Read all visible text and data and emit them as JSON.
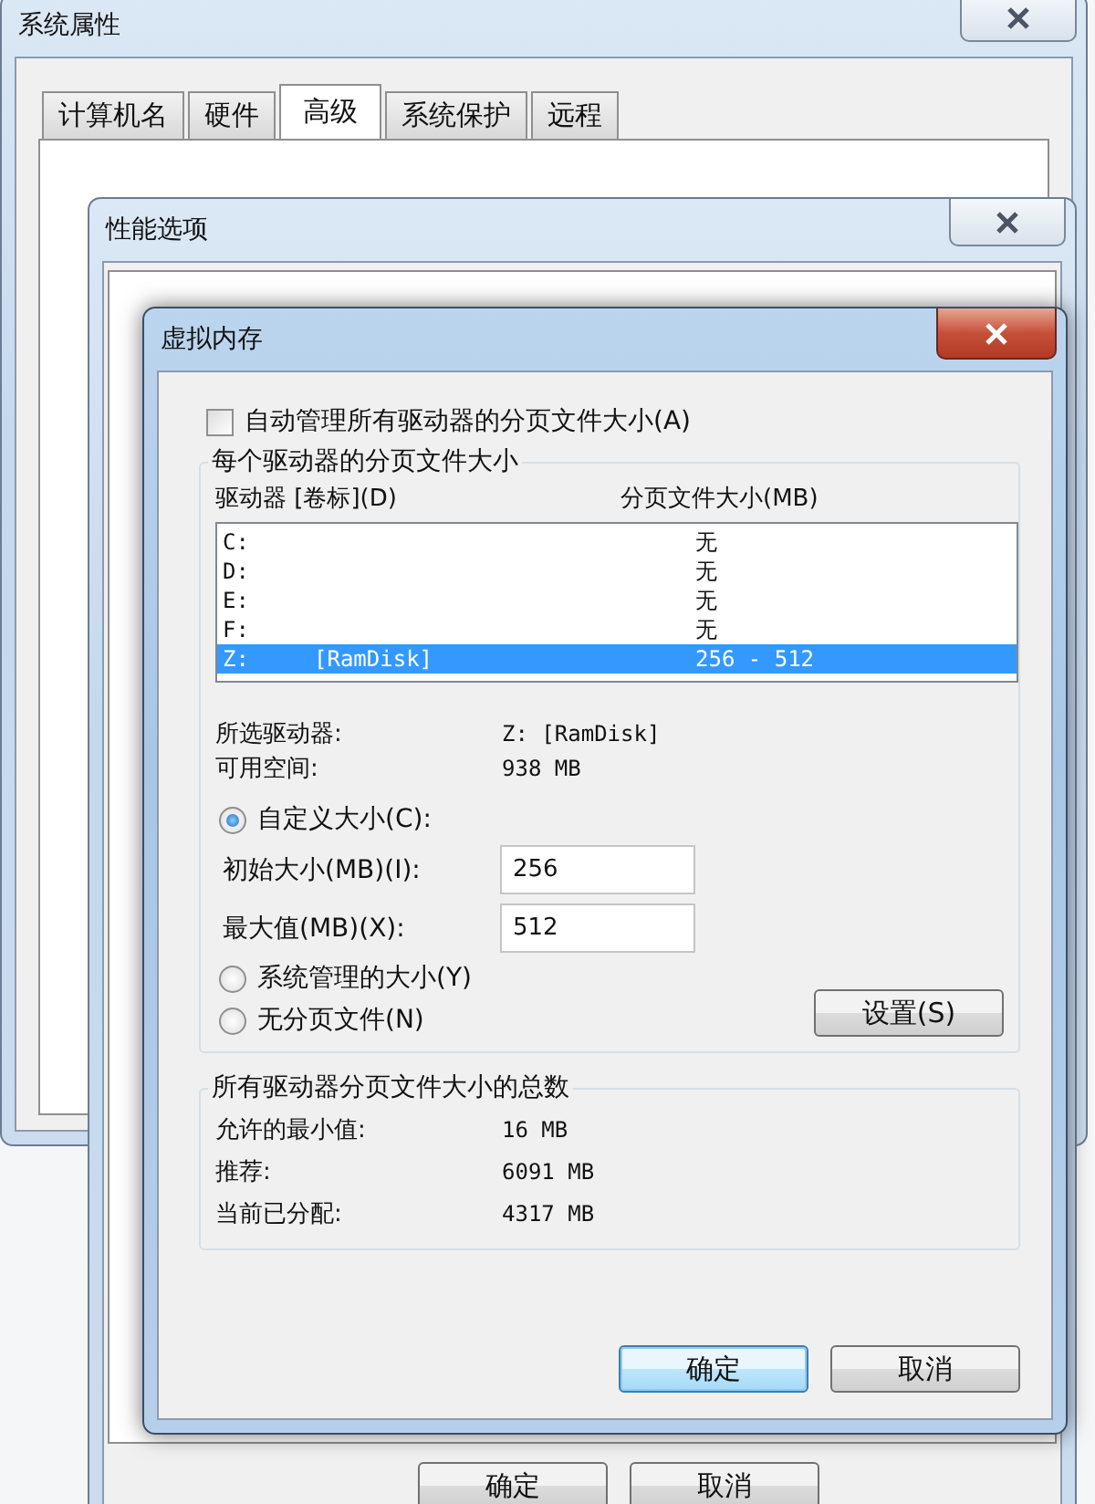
{
  "system_properties": {
    "title": "系统属性",
    "active": false,
    "tabs": [
      {
        "label": "计算机名",
        "selected": false
      },
      {
        "label": "硬件",
        "selected": false
      },
      {
        "label": "高级",
        "selected": true
      },
      {
        "label": "系统保护",
        "selected": false
      },
      {
        "label": "远程",
        "selected": false
      }
    ]
  },
  "performance_options": {
    "title": "性能选项",
    "active": false,
    "buttons": [
      {
        "label": "确定",
        "default": false
      },
      {
        "label": "取消",
        "default": false
      }
    ]
  },
  "virtual_memory": {
    "title": "虚拟内存",
    "active": true,
    "auto_manage": {
      "label": "自动管理所有驱动器的分页文件大小(A)",
      "checked": false
    },
    "per_drive": {
      "title": "每个驱动器的分页文件大小",
      "columns": [
        "驱动器 [卷标](D)",
        "分页文件大小(MB)"
      ],
      "drives": [
        {
          "drive": "C:",
          "size": "无",
          "selected": false
        },
        {
          "drive": "D:",
          "size": "无",
          "selected": false
        },
        {
          "drive": "E:",
          "size": "无",
          "selected": false
        },
        {
          "drive": "F:",
          "size": "无",
          "selected": false
        },
        {
          "drive": "Z:",
          "volume": "[RamDisk]",
          "size": "256 - 512",
          "selected": true
        }
      ],
      "info": [
        {
          "label": "所选驱动器:",
          "value": "Z:  [RamDisk]"
        },
        {
          "label": "可用空间:",
          "value": "938 MB"
        }
      ],
      "options": [
        {
          "kind": "custom",
          "label": "自定义大小(C):",
          "selected": true,
          "fields": [
            {
              "label": "初始大小(MB)(I):",
              "value": "256"
            },
            {
              "label": "最大值(MB)(X):",
              "value": "512"
            }
          ]
        },
        {
          "kind": "system",
          "label": "系统管理的大小(Y)",
          "selected": false
        },
        {
          "kind": "none",
          "label": "无分页文件(N)",
          "selected": false
        }
      ],
      "set_button": "设置(S)"
    },
    "totals": {
      "title": "所有驱动器分页文件大小的总数",
      "rows": [
        {
          "label": "允许的最小值:",
          "value": "16 MB"
        },
        {
          "label": "推荐:",
          "value": "6091 MB"
        },
        {
          "label": "当前已分配:",
          "value": "4317 MB"
        }
      ]
    },
    "buttons": [
      {
        "label": "确定",
        "default": true
      },
      {
        "label": "取消",
        "default": false
      }
    ]
  }
}
